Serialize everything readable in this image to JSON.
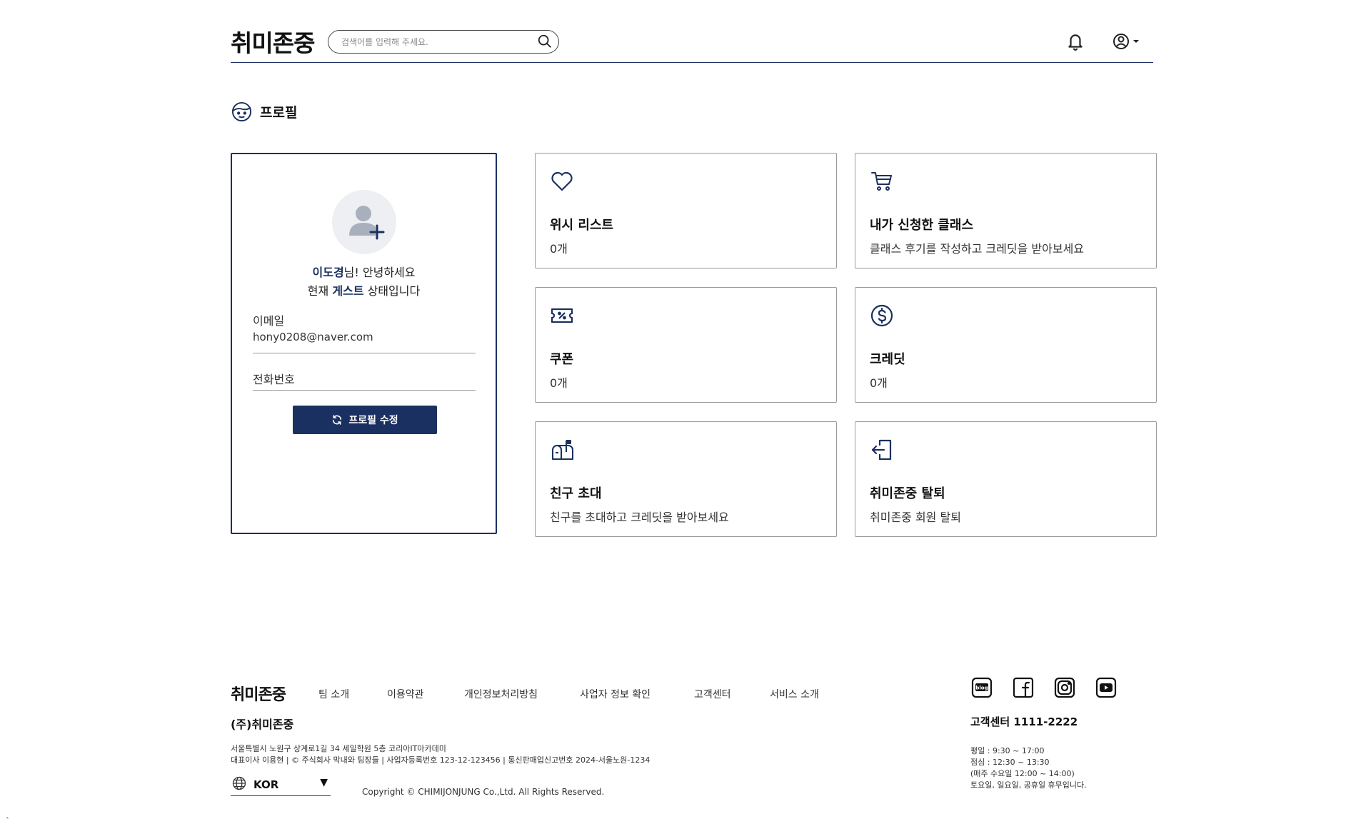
{
  "header": {
    "logo": "취미존중",
    "search_placeholder": "검색어를 입력해 주세요."
  },
  "section": {
    "title": "프로필"
  },
  "profile": {
    "name": "이도경",
    "greeting_suffix": "님! 안녕하세요",
    "status_prefix": "현재 ",
    "status": "게스트",
    "status_suffix": " 상태입니다",
    "email_label": "이메일",
    "email_value": "hony0208@naver.com",
    "phone_label": "전화번호",
    "edit_button": "프로필 수정"
  },
  "cards": [
    {
      "icon": "heart-icon",
      "title": "위시 리스트",
      "desc": "0개"
    },
    {
      "icon": "cart-icon",
      "title": "내가 신청한 클래스",
      "desc": "클래스 후기를 작성하고 크레딧을 받아보세요"
    },
    {
      "icon": "coupon-icon",
      "title": "쿠폰",
      "desc": "0개"
    },
    {
      "icon": "dollar-icon",
      "title": "크레딧",
      "desc": "0개"
    },
    {
      "icon": "mailbox-icon",
      "title": "친구 초대",
      "desc": "친구를 초대하고 크레딧을 받아보세요"
    },
    {
      "icon": "logout-icon",
      "title": "취미존중 탈퇴",
      "desc": "취미존중 회원 탈퇴"
    }
  ],
  "footer": {
    "logo": "취미존중",
    "nav": [
      "팀 소개",
      "이용약관",
      "개인정보처리방침",
      "사업자 정보 확인",
      "고객센터",
      "서비스 소개"
    ],
    "company": "(주)취미존중",
    "address1": "서울특별시 노원구 상계로1길 34 세일학원 5층 코리아IT아카데미",
    "address2": "대표이사 이용현 | © 주식회사 막내와 팀장들 | 사업자등록번호 123-12-123456 | 통신판매업신고번호 2024-서울노원-1234",
    "language": "KOR",
    "language_arrow": "▼",
    "copyright": "Copyright © CHIMIJONJUNG Co.,Ltd. All Rights Reserved.",
    "social": [
      "blog-icon",
      "facebook-icon",
      "instagram-icon",
      "youtube-icon"
    ],
    "blog_text": "blog",
    "cs_title": "고객센터 1111-2222",
    "cs_hours": [
      "평일 : 9:30 ~ 17:00",
      "점심 : 12:30 ~ 13:30",
      "(매주 수요일 12:00 ~ 14:00)",
      "토요일, 일요일, 공휴일 휴무입니다."
    ]
  },
  "stray_mark": "`",
  "colors": {
    "primary": "#1a3060",
    "border": "#9a9a9a",
    "avatar_bg": "#eeeff2"
  }
}
